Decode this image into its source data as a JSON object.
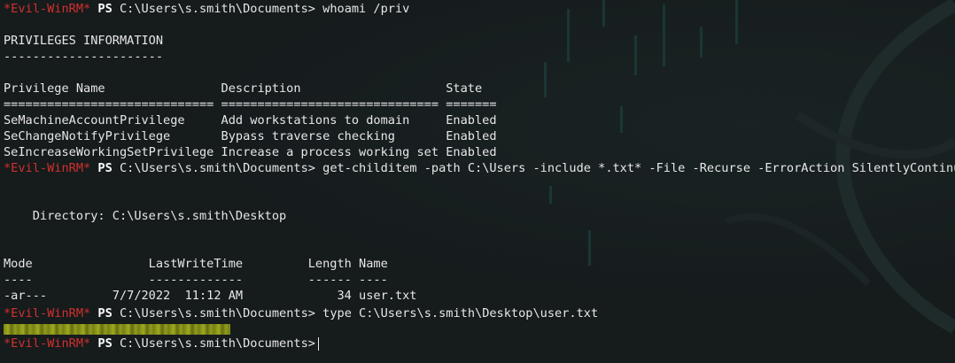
{
  "terminal": {
    "prompt": {
      "host": "*Evil-WinRM*",
      "ps": "PS",
      "path": "C:\\Users\\s.smith\\Documents>"
    },
    "commands": {
      "whoami": " whoami /priv",
      "childitem": " get-childitem -path C:\\Users -include *.txt* -File -Recurse -ErrorAction SilentlyContinue",
      "type": " type C:\\Users\\s.smith\\Desktop\\user.txt"
    },
    "priv": {
      "title": "PRIVILEGES INFORMATION",
      "underline": "----------------------",
      "header": "Privilege Name                Description                    State",
      "separator": "============================= ============================== =======",
      "rows": [
        "SeMachineAccountPrivilege     Add workstations to domain     Enabled",
        "SeChangeNotifyPrivilege       Bypass traverse checking       Enabled",
        "SeIncreaseWorkingSetPrivilege Increase a process working set Enabled"
      ]
    },
    "dir": {
      "directory": "    Directory: C:\\Users\\s.smith\\Desktop",
      "header": "Mode                LastWriteTime         Length Name",
      "separator": "----                -------------         ------ ----",
      "row": "-ar---         7/7/2022  11:12 AM             34 user.txt"
    },
    "colors": {
      "background": "#161b1c",
      "prompt_host": "#d0312d",
      "text": "#e7e7e7",
      "redaction": "#9aa61b"
    }
  }
}
